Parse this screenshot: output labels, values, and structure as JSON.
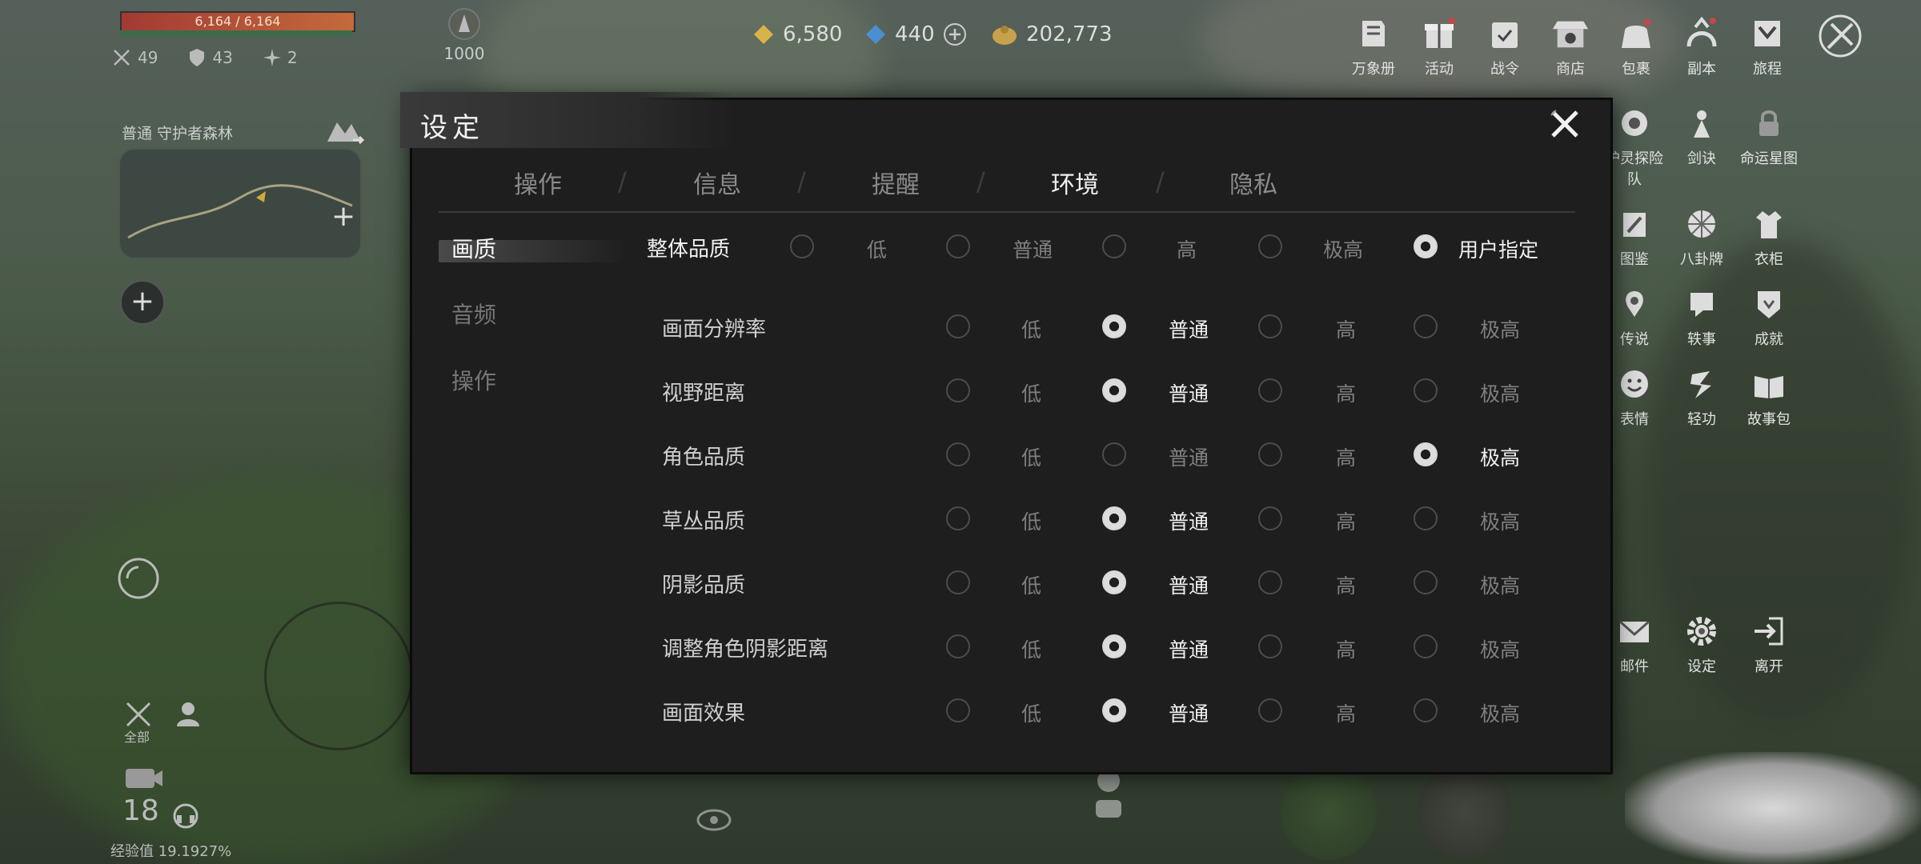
{
  "hud": {
    "hp_text": "6,164 / 6,164",
    "stats": [
      {
        "icon": "swords-icon",
        "value": "49"
      },
      {
        "icon": "shield-icon",
        "value": "43"
      },
      {
        "icon": "sparkle-icon",
        "value": "2"
      }
    ],
    "zone_label": "普通  守护者森林",
    "level": "1000",
    "currencies": [
      {
        "icon": "gold-gem-icon",
        "value": "6,580"
      },
      {
        "icon": "blue-gem-icon",
        "value": "440"
      },
      {
        "icon": "coin-pouch-icon",
        "value": "202,773"
      }
    ],
    "bottom_left": {
      "count": "18",
      "exp": "经验值 19.1927%",
      "all_label": "全部"
    }
  },
  "top_menu": [
    "万象册",
    "活动",
    "战令",
    "商店",
    "包裹",
    "副本",
    "旅程"
  ],
  "side_menu": [
    "护灵探险队",
    "剑诀",
    "命运星图",
    "图鉴",
    "八卦牌",
    "衣柜",
    "传说",
    "轶事",
    "成就",
    "表情",
    "轻功",
    "故事包"
  ],
  "bottom_menu": [
    "邮件",
    "设定",
    "离开"
  ],
  "dialog": {
    "title": "设定",
    "tabs": [
      "操作",
      "信息",
      "提醒",
      "环境",
      "隐私"
    ],
    "active_tab": 3,
    "left_nav": [
      "画质",
      "音频",
      "操作"
    ],
    "active_nav": 0,
    "overall": {
      "label": "整体品质",
      "options": [
        "低",
        "普通",
        "高",
        "极高",
        "用户指定"
      ],
      "selected": 4
    },
    "settings": [
      {
        "label": "画面分辨率",
        "options": [
          "低",
          "普通",
          "高",
          "极高"
        ],
        "selected": 1
      },
      {
        "label": "视野距离",
        "options": [
          "低",
          "普通",
          "高",
          "极高"
        ],
        "selected": 1
      },
      {
        "label": "角色品质",
        "options": [
          "低",
          "普通",
          "高",
          "极高"
        ],
        "selected": 3
      },
      {
        "label": "草丛品质",
        "options": [
          "低",
          "普通",
          "高",
          "极高"
        ],
        "selected": 1
      },
      {
        "label": "阴影品质",
        "options": [
          "低",
          "普通",
          "高",
          "极高"
        ],
        "selected": 1
      },
      {
        "label": "调整角色阴影距离",
        "options": [
          "低",
          "普通",
          "高",
          "极高"
        ],
        "selected": 1
      },
      {
        "label": "画面效果",
        "options": [
          "低",
          "普通",
          "高",
          "极高"
        ],
        "selected": 1
      }
    ]
  },
  "colors": {
    "panel_bg": "#1e1e1e",
    "text_active": "#f0f0f0",
    "text_inactive": "#7f7f7f"
  }
}
